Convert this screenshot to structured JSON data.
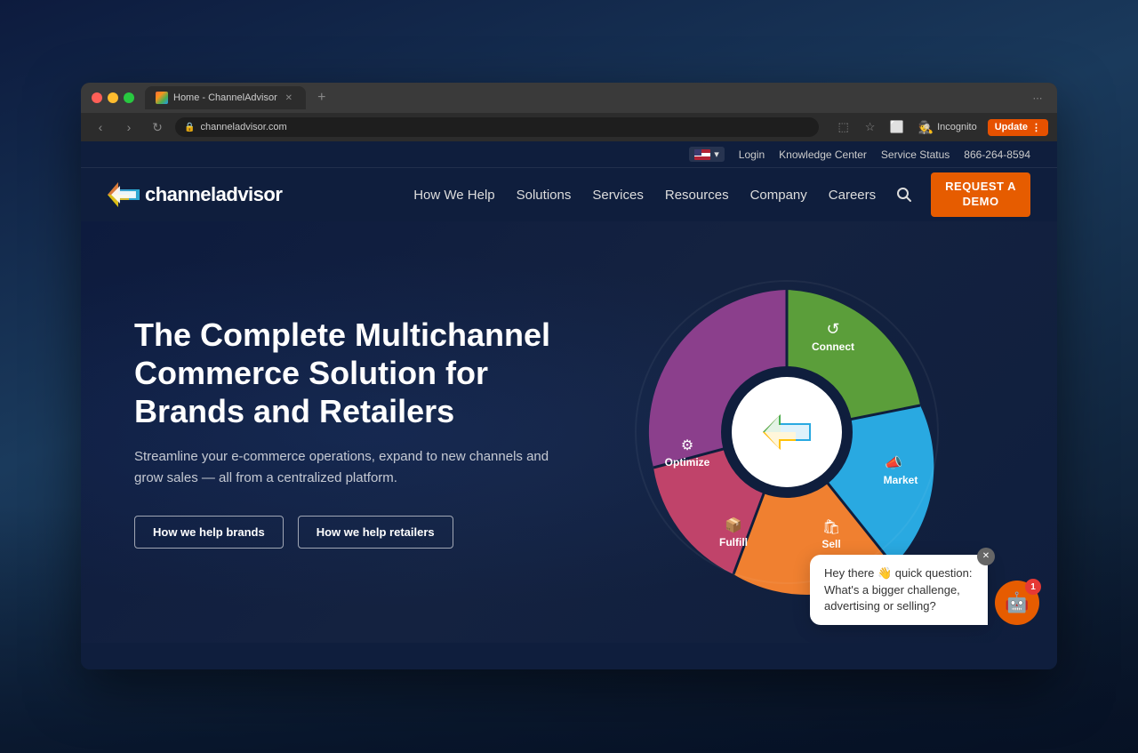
{
  "desktop": {
    "bg": "dark blue gradient"
  },
  "browser": {
    "tab_title": "Home - ChannelAdvisor",
    "url": "channeladvisor.com",
    "incognito_label": "Incognito",
    "update_label": "Update"
  },
  "utility_bar": {
    "login_label": "Login",
    "knowledge_center_label": "Knowledge Center",
    "service_status_label": "Service Status",
    "phone": "866-264-8594"
  },
  "nav": {
    "logo_text": "channeladvisor",
    "how_we_help": "How We Help",
    "solutions": "Solutions",
    "services": "Services",
    "resources": "Resources",
    "company": "Company",
    "careers": "Careers",
    "demo_line1": "REQUEST A",
    "demo_line2": "DEMO"
  },
  "hero": {
    "title": "The Complete Multichannel Commerce Solution for Brands and Retailers",
    "subtitle": "Streamline your e-commerce operations, expand to new channels and grow sales — all from a centralized platform.",
    "btn_brands": "How we help brands",
    "btn_retailers": "How we help retailers"
  },
  "wheel": {
    "segments": [
      {
        "label": "Connect",
        "color": "#5b9e3a",
        "icon": "↺",
        "angle_start": -90,
        "angle_end": 10
      },
      {
        "label": "Market",
        "color": "#29a9e1",
        "icon": "📢",
        "angle_start": 10,
        "angle_end": 110
      },
      {
        "label": "Sell",
        "color": "#f08030",
        "icon": "🛍",
        "angle_start": 110,
        "angle_end": 190
      },
      {
        "label": "Fulfill",
        "color": "#c0436a",
        "icon": "📦",
        "angle_start": 190,
        "angle_end": 270
      },
      {
        "label": "Optimize",
        "color": "#8b3f8c",
        "icon": "⚙",
        "angle_start": 270,
        "angle_end": 360
      }
    ]
  },
  "chat": {
    "message": "Hey there 👋 quick question: What's a bigger challenge, advertising or selling?",
    "badge_count": "1",
    "avatar_icon": "🤖"
  }
}
